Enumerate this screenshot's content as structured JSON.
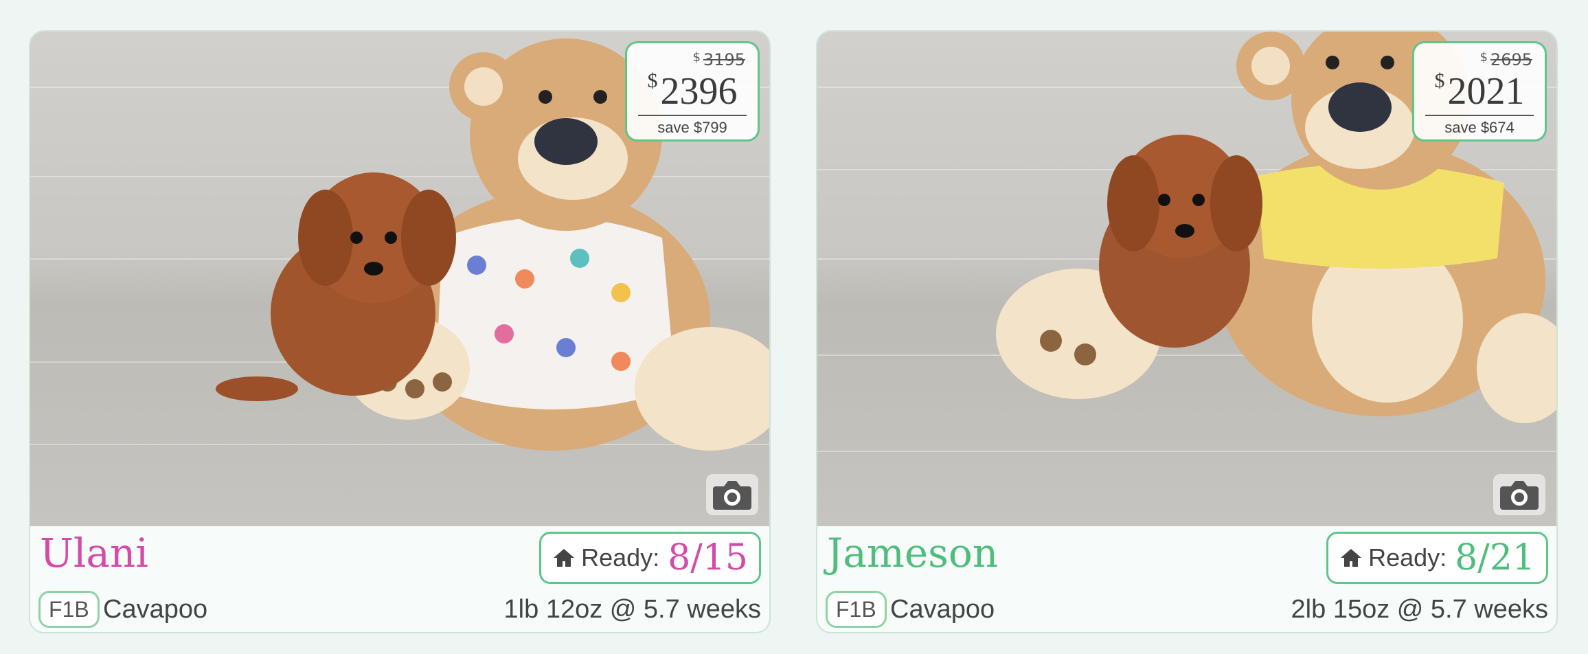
{
  "listings": [
    {
      "name": "Ulani",
      "price": {
        "currency": "$",
        "original": "3195",
        "current": "2396",
        "savings": "save $799"
      },
      "ready_label": "Ready:",
      "ready_date": "8/15",
      "generation": "F1B",
      "breed": "Cavapoo",
      "weight_age": "1lb 12oz @ 5.7 weeks",
      "accent_color": "#d44aa8",
      "photo_icon": "camera-icon",
      "home_icon": "home-icon"
    },
    {
      "name": "Jameson",
      "price": {
        "currency": "$",
        "original": "2695",
        "current": "2021",
        "savings": "save $674"
      },
      "ready_label": "Ready:",
      "ready_date": "8/21",
      "generation": "F1B",
      "breed": "Cavapoo",
      "weight_age": "2lb 15oz @ 5.7 weeks",
      "accent_color": "#4fbd7c",
      "photo_icon": "camera-icon",
      "home_icon": "home-icon"
    }
  ],
  "colors": {
    "badge_border": "#5fc58a",
    "background": "#eef5f2"
  }
}
